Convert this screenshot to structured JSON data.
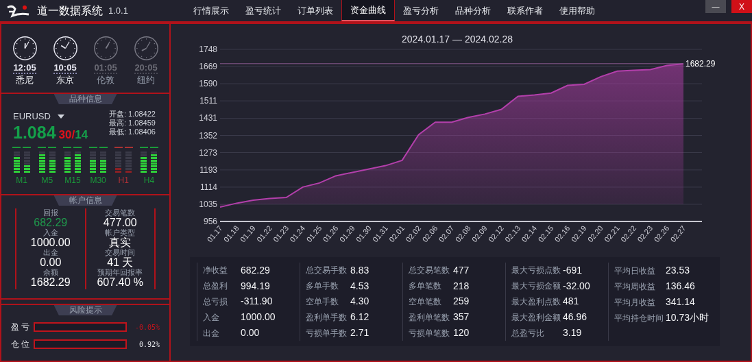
{
  "app": {
    "title": "道一数据系统",
    "version": "1.0.1"
  },
  "nav_tabs": [
    {
      "label": "行情展示",
      "selected": false
    },
    {
      "label": "盈亏统计",
      "selected": false
    },
    {
      "label": "订单列表",
      "selected": false
    },
    {
      "label": "资金曲线",
      "selected": true
    },
    {
      "label": "盈亏分析",
      "selected": false
    },
    {
      "label": "品种分析",
      "selected": false
    },
    {
      "label": "联系作者",
      "selected": false
    },
    {
      "label": "使用帮助",
      "selected": false
    }
  ],
  "window_controls": {
    "minimize": "—",
    "close": "X"
  },
  "clocks": [
    {
      "time": "12:05",
      "city": "悉尼",
      "active": true
    },
    {
      "time": "10:05",
      "city": "东京",
      "active": true
    },
    {
      "time": "01:05",
      "city": "伦敦",
      "active": false
    },
    {
      "time": "20:05",
      "city": "纽约",
      "active": false
    }
  ],
  "symbol_info": {
    "section_title": "品种信息",
    "symbol": "EURUSD",
    "price": "1.084",
    "price_digits_up": "30",
    "separator": "/",
    "price_digits_down": "14",
    "quotes": [
      {
        "label": "开盘:",
        "value": "1.08422"
      },
      {
        "label": "最高:",
        "value": "1.08459"
      },
      {
        "label": "最低:",
        "value": "1.08406"
      }
    ],
    "timeframes": [
      {
        "label": "M1",
        "down": false,
        "meters": [
          {
            "level": 0.75
          },
          {
            "level": 0.38
          }
        ]
      },
      {
        "label": "M5",
        "down": false,
        "meters": [
          {
            "level": 0.88
          },
          {
            "level": 0.62
          }
        ]
      },
      {
        "label": "M15",
        "down": false,
        "meters": [
          {
            "level": 0.75
          },
          {
            "level": 0.88
          }
        ]
      },
      {
        "label": "M30",
        "down": false,
        "meters": [
          {
            "level": 0.62
          },
          {
            "level": 0.62
          }
        ]
      },
      {
        "label": "H1",
        "down": true,
        "meters": [
          {
            "level": 0.25
          },
          {
            "level": 0.12
          }
        ]
      },
      {
        "label": "H4",
        "down": false,
        "meters": [
          {
            "level": 0.75
          },
          {
            "level": 0.88
          }
        ]
      }
    ]
  },
  "account_info": {
    "section_title": "帐户信息",
    "columns": [
      [
        {
          "label": "回报",
          "value": "682.29",
          "highlight": true
        },
        {
          "label": "入金",
          "value": "1000.00",
          "highlight": false
        },
        {
          "label": "出金",
          "value": "0.00",
          "highlight": false
        },
        {
          "label": "余额",
          "value": "1682.29",
          "highlight": false
        }
      ],
      [
        {
          "label": "交易笔数",
          "value": "477.00",
          "highlight": false
        },
        {
          "label": "帐户类型",
          "value": "真实",
          "highlight": false
        },
        {
          "label": "交易时间",
          "value": "41 天",
          "highlight": false
        },
        {
          "label": "预期年回报率",
          "value": "607.40 %",
          "highlight": false
        }
      ]
    ]
  },
  "risk": {
    "section_title": "风险提示",
    "rows": [
      {
        "label": "盈 亏",
        "level": 0,
        "value": "-0.05%",
        "negative": true
      },
      {
        "label": "仓 位",
        "level": 0,
        "value": "0.92%",
        "negative": false
      }
    ]
  },
  "equity_chart": {
    "chart_data": {
      "type": "area",
      "title": "2024.01.17 — 2024.02.28",
      "categories": [
        "01.17",
        "01.18",
        "01.19",
        "01.22",
        "01.23",
        "01.24",
        "01.25",
        "01.26",
        "01.29",
        "01.30",
        "01.31",
        "02.01",
        "02.02",
        "02.06",
        "02.07",
        "02.08",
        "02.09",
        "02.12",
        "02.13",
        "02.14",
        "02.15",
        "02.16",
        "02.19",
        "02.20",
        "02.21",
        "02.22",
        "02.23",
        "02.26",
        "02.27"
      ],
      "series": [
        {
          "color": "#b33fab",
          "values": [
            1022,
            1040,
            1054,
            1062,
            1066,
            1114,
            1133,
            1166,
            1182,
            1197,
            1213,
            1237,
            1355,
            1413,
            1413,
            1435,
            1450,
            1472,
            1532,
            1538,
            1547,
            1582,
            1587,
            1622,
            1648,
            1652,
            1655,
            1674,
            1682
          ]
        }
      ],
      "ylim": [
        956,
        1748
      ],
      "yticks": [
        956,
        1035,
        1114,
        1193,
        1273,
        1352,
        1431,
        1511,
        1590,
        1669,
        1748
      ],
      "grid": true,
      "ref_lines": [
        {
          "axis": "y",
          "value": 1682.29,
          "label": "1682.29"
        }
      ]
    }
  },
  "stats": [
    [
      {
        "label": "净收益",
        "value": "682.29"
      },
      {
        "label": "总盈利",
        "value": "994.19"
      },
      {
        "label": "总亏损",
        "value": "-311.90"
      },
      {
        "label": "入金",
        "value": "1000.00"
      },
      {
        "label": "出金",
        "value": "0.00"
      }
    ],
    [
      {
        "label": "总交易手数",
        "value": "8.83"
      },
      {
        "label": "多单手数",
        "value": "4.53"
      },
      {
        "label": "空单手数",
        "value": "4.30"
      },
      {
        "label": "盈利单手数",
        "value": "6.12"
      },
      {
        "label": "亏损单手数",
        "value": "2.71"
      }
    ],
    [
      {
        "label": "总交易笔数",
        "value": "477"
      },
      {
        "label": "多单笔数",
        "value": "218"
      },
      {
        "label": "空单笔数",
        "value": "259"
      },
      {
        "label": "盈利单笔数",
        "value": "357"
      },
      {
        "label": "亏损单笔数",
        "value": "120"
      }
    ],
    [
      {
        "label": "最大亏损点数",
        "value": "-691"
      },
      {
        "label": "最大亏损金额",
        "value": "-32.00"
      },
      {
        "label": "最大盈利点数",
        "value": "481"
      },
      {
        "label": "最大盈利金额",
        "value": "46.96"
      },
      {
        "label": "总盈亏比",
        "value": "3.19"
      }
    ],
    [
      {
        "label": "平均日收益",
        "value": "23.53"
      },
      {
        "label": "平均周收益",
        "value": "136.46"
      },
      {
        "label": "平均月收益",
        "value": "341.14"
      },
      {
        "label": "平均持仓时间",
        "value": "10.73小时"
      }
    ]
  ]
}
